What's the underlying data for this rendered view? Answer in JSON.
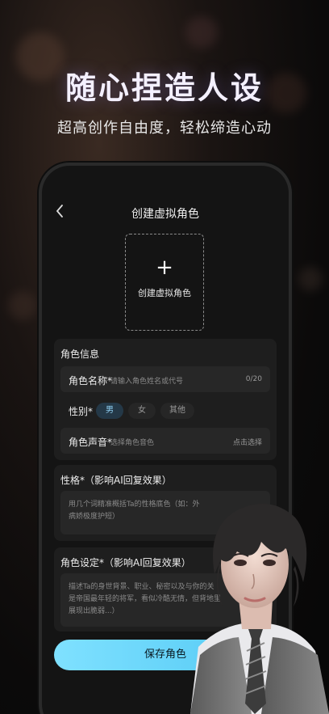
{
  "hero": {
    "title": "随心捏造人设",
    "subtitle": "超高创作自由度，轻松缔造心动"
  },
  "phone": {
    "nav": {
      "back_icon": "chevron-left-icon",
      "title": "创建虚拟角色"
    },
    "upload": {
      "icon": "plus-icon",
      "label": "创建虚拟角色"
    },
    "info_card": {
      "title": "角色信息",
      "name": {
        "label": "角色名称*",
        "placeholder": "请输入角色姓名或代号",
        "counter": "0/20"
      },
      "gender": {
        "label": "性别*",
        "options": [
          "男",
          "女",
          "其他"
        ],
        "selected": "男"
      },
      "voice": {
        "label": "角色声音*",
        "placeholder": "选择角色音色",
        "action": "点击选择"
      }
    },
    "personality_card": {
      "title": "性格*（影响AI回复效果）",
      "placeholder_lines": [
        "用几个词精准概括Ta的性格底色（如：外",
        "病娇极度护短）"
      ]
    },
    "setting_card": {
      "title": "角色设定*（影响AI回复效果）",
      "placeholder_lines": [
        "描述Ta的身世背景、职业、秘密以及与你的关",
        "是帝国最年轻的将军，看似冷酷无情，但背地里",
        "展现出脆弱...）"
      ]
    },
    "save_label": "保存角色"
  },
  "colors": {
    "accent": "#6fd6fb",
    "chip_active_bg": "#243847",
    "card_bg": "#1e1e1e"
  }
}
